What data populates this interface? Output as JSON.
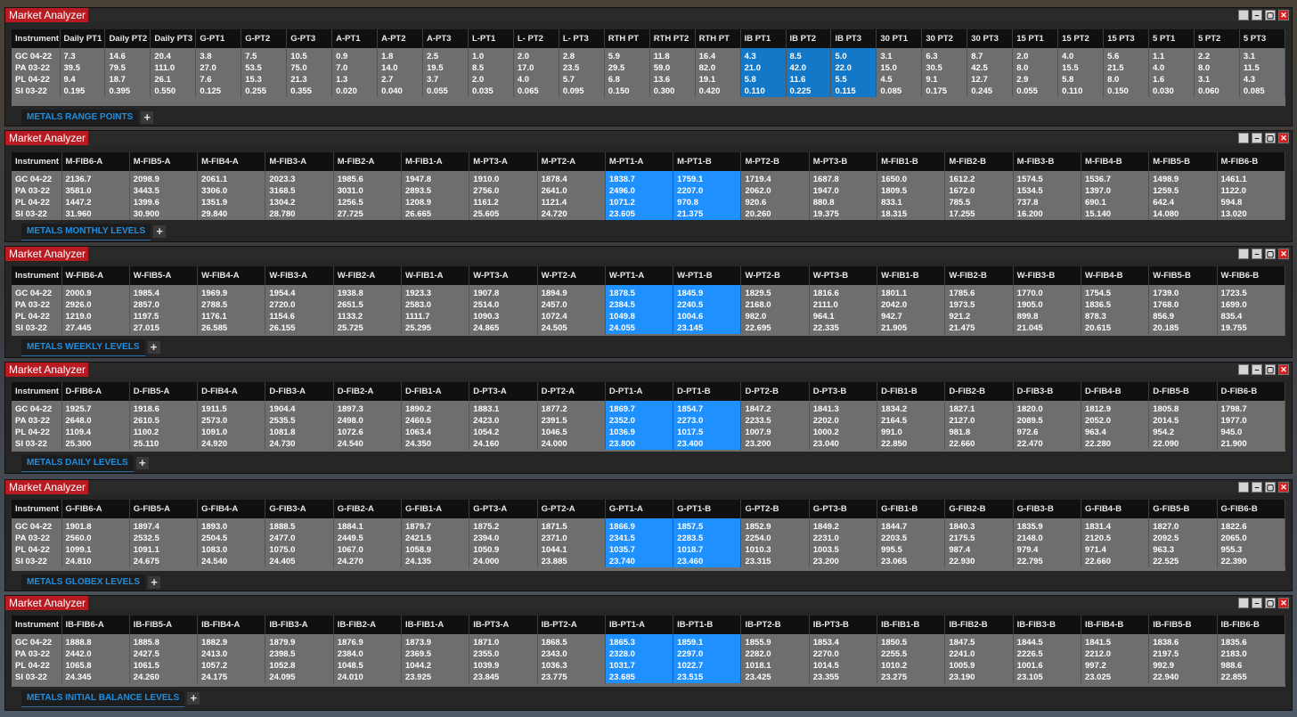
{
  "window_title": "Market Analyzer",
  "instrument_header": "Instrument",
  "instruments": [
    "GC 04-22",
    "PA 03-22",
    "PL 04-22",
    "SI 03-22"
  ],
  "add_tab_label": "+",
  "highlight_color": "#1e90ff",
  "panels": [
    {
      "tab_label": "METALS RANGE POINTS",
      "columns": [
        "Daily PT1",
        "Daily PT2",
        "Daily PT3",
        "G-PT1",
        "G-PT2",
        "G-PT3",
        "A-PT1",
        "A-PT2",
        "A-PT3",
        "L-PT1",
        "L- PT2",
        "L- PT3",
        "RTH PT",
        "RTH PT2",
        "RTH PT",
        "IB PT1",
        "IB PT2",
        "IB PT3",
        "30 PT1",
        "30 PT2",
        "30 PT3",
        "15 PT1",
        "15 PT2",
        "15 PT3",
        "5 PT1",
        "5 PT2",
        "5 PT3"
      ],
      "highlight": [
        15,
        16,
        17
      ],
      "rows": [
        [
          "7.3",
          "14.6",
          "20.4",
          "3.8",
          "7.5",
          "10.5",
          "0.9",
          "1.8",
          "2.5",
          "1.0",
          "2.0",
          "2.8",
          "5.9",
          "11.8",
          "16.4",
          "4.3",
          "8.5",
          "5.0",
          "3.1",
          "6.3",
          "8.7",
          "2.0",
          "4.0",
          "5.6",
          "1.1",
          "2.2",
          "3.1"
        ],
        [
          "39.5",
          "79.5",
          "111.0",
          "27.0",
          "53.5",
          "75.0",
          "7.0",
          "14.0",
          "19.5",
          "8.5",
          "17.0",
          "23.5",
          "29.5",
          "59.0",
          "82.0",
          "21.0",
          "42.0",
          "22.0",
          "15.0",
          "30.5",
          "42.5",
          "8.0",
          "15.5",
          "21.5",
          "4.0",
          "8.0",
          "11.5"
        ],
        [
          "9.4",
          "18.7",
          "26.1",
          "7.6",
          "15.3",
          "21.3",
          "1.3",
          "2.7",
          "3.7",
          "2.0",
          "4.0",
          "5.7",
          "6.8",
          "13.6",
          "19.1",
          "5.8",
          "11.6",
          "5.5",
          "4.5",
          "9.1",
          "12.7",
          "2.9",
          "5.8",
          "8.0",
          "1.6",
          "3.1",
          "4.3"
        ],
        [
          "0.195",
          "0.395",
          "0.550",
          "0.125",
          "0.255",
          "0.355",
          "0.020",
          "0.040",
          "0.055",
          "0.035",
          "0.065",
          "0.095",
          "0.150",
          "0.300",
          "0.420",
          "0.110",
          "0.225",
          "0.115",
          "0.085",
          "0.175",
          "0.245",
          "0.055",
          "0.110",
          "0.150",
          "0.030",
          "0.060",
          "0.085"
        ]
      ]
    },
    {
      "tab_label": "METALS MONTHLY LEVELS",
      "columns": [
        "M-FIB6-A",
        "M-FIB5-A",
        "M-FIB4-A",
        "M-FIB3-A",
        "M-FIB2-A",
        "M-FIB1-A",
        "M-PT3-A",
        "M-PT2-A",
        "M-PT1-A",
        "M-PT1-B",
        "M-PT2-B",
        "M-PT3-B",
        "M-FIB1-B",
        "M-FIB2-B",
        "M-FIB3-B",
        "M-FIB4-B",
        "M-FIB5-B",
        "M-FIB6-B"
      ],
      "highlight": [
        8,
        9
      ],
      "rows": [
        [
          "2136.7",
          "2098.9",
          "2061.1",
          "2023.3",
          "1985.6",
          "1947.8",
          "1910.0",
          "1878.4",
          "1838.7",
          "1759.1",
          "1719.4",
          "1687.8",
          "1650.0",
          "1612.2",
          "1574.5",
          "1536.7",
          "1498.9",
          "1461.1"
        ],
        [
          "3581.0",
          "3443.5",
          "3306.0",
          "3168.5",
          "3031.0",
          "2893.5",
          "2756.0",
          "2641.0",
          "2496.0",
          "2207.0",
          "2062.0",
          "1947.0",
          "1809.5",
          "1672.0",
          "1534.5",
          "1397.0",
          "1259.5",
          "1122.0"
        ],
        [
          "1447.2",
          "1399.6",
          "1351.9",
          "1304.2",
          "1256.5",
          "1208.9",
          "1161.2",
          "1121.4",
          "1071.2",
          "970.8",
          "920.6",
          "880.8",
          "833.1",
          "785.5",
          "737.8",
          "690.1",
          "642.4",
          "594.8"
        ],
        [
          "31.960",
          "30.900",
          "29.840",
          "28.780",
          "27.725",
          "26.665",
          "25.605",
          "24.720",
          "23.605",
          "21.375",
          "20.260",
          "19.375",
          "18.315",
          "17.255",
          "16.200",
          "15.140",
          "14.080",
          "13.020"
        ]
      ]
    },
    {
      "tab_label": "METALS WEEKLY LEVELS",
      "columns": [
        "W-FIB6-A",
        "W-FIB5-A",
        "W-FIB4-A",
        "W-FIB3-A",
        "W-FIB2-A",
        "W-FIB1-A",
        "W-PT3-A",
        "W-PT2-A",
        "W-PT1-A",
        "W-PT1-B",
        "W-PT2-B",
        "W-PT3-B",
        "W-FIB1-B",
        "W-FIB2-B",
        "W-FIB3-B",
        "W-FIB4-B",
        "W-FIB5-B",
        "W-FIB6-B"
      ],
      "highlight": [
        8,
        9
      ],
      "rows": [
        [
          "2000.9",
          "1985.4",
          "1969.9",
          "1954.4",
          "1938.8",
          "1923.3",
          "1907.8",
          "1894.9",
          "1878.5",
          "1845.9",
          "1829.5",
          "1816.6",
          "1801.1",
          "1785.6",
          "1770.0",
          "1754.5",
          "1739.0",
          "1723.5"
        ],
        [
          "2926.0",
          "2857.0",
          "2788.5",
          "2720.0",
          "2651.5",
          "2583.0",
          "2514.0",
          "2457.0",
          "2384.5",
          "2240.5",
          "2168.0",
          "2111.0",
          "2042.0",
          "1973.5",
          "1905.0",
          "1836.5",
          "1768.0",
          "1699.0"
        ],
        [
          "1219.0",
          "1197.5",
          "1176.1",
          "1154.6",
          "1133.2",
          "1111.7",
          "1090.3",
          "1072.4",
          "1049.8",
          "1004.6",
          "982.0",
          "964.1",
          "942.7",
          "921.2",
          "899.8",
          "878.3",
          "856.9",
          "835.4"
        ],
        [
          "27.445",
          "27.015",
          "26.585",
          "26.155",
          "25.725",
          "25.295",
          "24.865",
          "24.505",
          "24.055",
          "23.145",
          "22.695",
          "22.335",
          "21.905",
          "21.475",
          "21.045",
          "20.615",
          "20.185",
          "19.755"
        ]
      ]
    },
    {
      "tab_label": "METALS DAILY LEVELS",
      "columns": [
        "D-FIB6-A",
        "D-FIB5-A",
        "D-FIB4-A",
        "D-FIB3-A",
        "D-FIB2-A",
        "D-FIB1-A",
        "D-PT3-A",
        "D-PT2-A",
        "D-PT1-A",
        "D-PT1-B",
        "D-PT2-B",
        "D-PT3-B",
        "D-FIB1-B",
        "D-FIB2-B",
        "D-FIB3-B",
        "D-FIB4-B",
        "D-FIB5-B",
        "D-FIB6-B"
      ],
      "highlight": [
        8,
        9
      ],
      "rows": [
        [
          "1925.7",
          "1918.6",
          "1911.5",
          "1904.4",
          "1897.3",
          "1890.2",
          "1883.1",
          "1877.2",
          "1869.7",
          "1854.7",
          "1847.2",
          "1841.3",
          "1834.2",
          "1827.1",
          "1820.0",
          "1812.9",
          "1805.8",
          "1798.7"
        ],
        [
          "2648.0",
          "2610.5",
          "2573.0",
          "2535.5",
          "2498.0",
          "2460.5",
          "2423.0",
          "2391.5",
          "2352.0",
          "2273.0",
          "2233.5",
          "2202.0",
          "2164.5",
          "2127.0",
          "2089.5",
          "2052.0",
          "2014.5",
          "1977.0"
        ],
        [
          "1109.4",
          "1100.2",
          "1091.0",
          "1081.8",
          "1072.6",
          "1063.4",
          "1054.2",
          "1046.5",
          "1036.9",
          "1017.5",
          "1007.9",
          "1000.2",
          "991.0",
          "981.8",
          "972.6",
          "963.4",
          "954.2",
          "945.0"
        ],
        [
          "25.300",
          "25.110",
          "24.920",
          "24.730",
          "24.540",
          "24.350",
          "24.160",
          "24.000",
          "23.800",
          "23.400",
          "23.200",
          "23.040",
          "22.850",
          "22.660",
          "22.470",
          "22.280",
          "22.090",
          "21.900"
        ]
      ]
    },
    {
      "tab_label": "METALS GLOBEX LEVELS",
      "columns": [
        "G-FIB6-A",
        "G-FIB5-A",
        "G-FIB4-A",
        "G-FIB3-A",
        "G-FIB2-A",
        "G-FIB1-A",
        "G-PT3-A",
        "G-PT2-A",
        "G-PT1-A",
        "G-PT1-B",
        "G-PT2-B",
        "G-PT3-B",
        "G-FIB1-B",
        "G-FIB2-B",
        "G-FIB3-B",
        "G-FIB4-B",
        "G-FIB5-B",
        "G-FIB6-B"
      ],
      "highlight": [
        8,
        9
      ],
      "rows": [
        [
          "1901.8",
          "1897.4",
          "1893.0",
          "1888.5",
          "1884.1",
          "1879.7",
          "1875.2",
          "1871.5",
          "1866.9",
          "1857.5",
          "1852.9",
          "1849.2",
          "1844.7",
          "1840.3",
          "1835.9",
          "1831.4",
          "1827.0",
          "1822.6"
        ],
        [
          "2560.0",
          "2532.5",
          "2504.5",
          "2477.0",
          "2449.5",
          "2421.5",
          "2394.0",
          "2371.0",
          "2341.5",
          "2283.5",
          "2254.0",
          "2231.0",
          "2203.5",
          "2175.5",
          "2148.0",
          "2120.5",
          "2092.5",
          "2065.0"
        ],
        [
          "1099.1",
          "1091.1",
          "1083.0",
          "1075.0",
          "1067.0",
          "1058.9",
          "1050.9",
          "1044.1",
          "1035.7",
          "1018.7",
          "1010.3",
          "1003.5",
          "995.5",
          "987.4",
          "979.4",
          "971.4",
          "963.3",
          "955.3"
        ],
        [
          "24.810",
          "24.675",
          "24.540",
          "24.405",
          "24.270",
          "24.135",
          "24.000",
          "23.885",
          "23.740",
          "23.460",
          "23.315",
          "23.200",
          "23.065",
          "22.930",
          "22.795",
          "22.660",
          "22.525",
          "22.390"
        ]
      ]
    },
    {
      "tab_label": "METALS  INITIAL BALANCE LEVELS",
      "columns": [
        "IB-FIB6-A",
        "IB-FIB5-A",
        "IB-FIB4-A",
        "IB-FIB3-A",
        "IB-FIB2-A",
        "IB-FIB1-A",
        "IB-PT3-A",
        "IB-PT2-A",
        "IB-PT1-A",
        "IB-PT1-B",
        "IB-PT2-B",
        "IB-PT3-B",
        "IB-FIB1-B",
        "IB-FIB2-B",
        "IB-FIB3-B",
        "IB-FIB4-B",
        "IB-FIB5-B",
        "IB-FIB6-B"
      ],
      "highlight": [
        8,
        9
      ],
      "rows": [
        [
          "1888.8",
          "1885.8",
          "1882.9",
          "1879.9",
          "1876.9",
          "1873.9",
          "1871.0",
          "1868.5",
          "1865.3",
          "1859.1",
          "1855.9",
          "1853.4",
          "1850.5",
          "1847.5",
          "1844.5",
          "1841.5",
          "1838.6",
          "1835.6"
        ],
        [
          "2442.0",
          "2427.5",
          "2413.0",
          "2398.5",
          "2384.0",
          "2369.5",
          "2355.0",
          "2343.0",
          "2328.0",
          "2297.0",
          "2282.0",
          "2270.0",
          "2255.5",
          "2241.0",
          "2226.5",
          "2212.0",
          "2197.5",
          "2183.0"
        ],
        [
          "1065.8",
          "1061.5",
          "1057.2",
          "1052.8",
          "1048.5",
          "1044.2",
          "1039.9",
          "1036.3",
          "1031.7",
          "1022.7",
          "1018.1",
          "1014.5",
          "1010.2",
          "1005.9",
          "1001.6",
          "997.2",
          "992.9",
          "988.6"
        ],
        [
          "24.345",
          "24.260",
          "24.175",
          "24.095",
          "24.010",
          "23.925",
          "23.845",
          "23.775",
          "23.685",
          "23.515",
          "23.425",
          "23.355",
          "23.275",
          "23.190",
          "23.105",
          "23.025",
          "22.940",
          "22.855"
        ]
      ]
    }
  ]
}
